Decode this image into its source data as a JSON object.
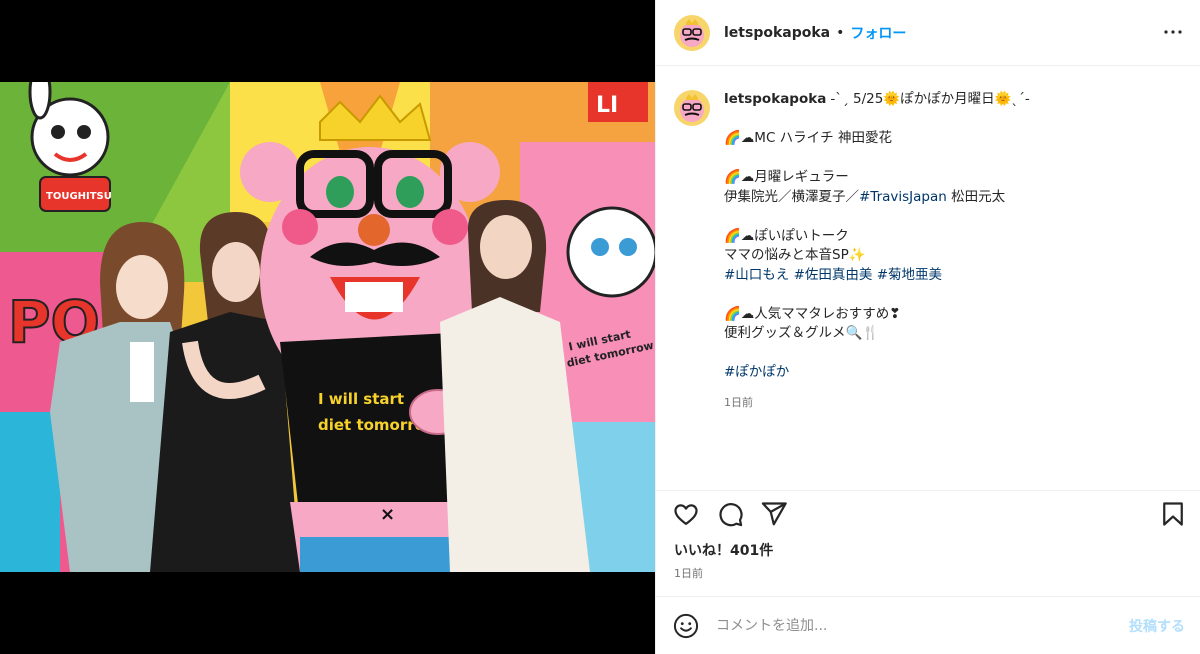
{
  "post": {
    "username": "letspokapoka",
    "follow_label": "フォロー",
    "header_separator": "•",
    "more_icon": "more-horizontal-icon"
  },
  "photo": {
    "shirt_line1": "I will start",
    "shirt_line2": "diet tomorrow",
    "poster_text1": "I will start",
    "poster_text2": "diet tomorrow",
    "sticker_text": "TOUGHITSU",
    "banner_text": "LI",
    "wall_text": "PO"
  },
  "caption": {
    "username": "letspokapoka",
    "lines": [
      "-ˋˏ 5/25🌞ぽかぽか月曜日🌞ˎˊ-",
      "",
      "🌈☁MC ハライチ 神田愛花",
      "",
      "🌈☁月曜レギュラー",
      "伊集院光／横澤夏子／",
      "",
      "🌈☁ぽいぽいトーク",
      "ママの悩みと本音SP✨",
      "",
      "",
      "🌈☁人気ママタレおすすめ❣",
      "便利グッズ＆グルメ🔍🍴",
      ""
    ],
    "line5_tag": "#TravisJapan",
    "line5_rest": " 松田元太",
    "hashtags_line": [
      "#山口もえ",
      "#佐田真由美",
      "#菊地亜美"
    ],
    "final_tag": "#ぽかぽか",
    "time": "1日前"
  },
  "actions": {
    "like_icon": "heart-icon",
    "comment_icon": "comment-icon",
    "share_icon": "send-icon",
    "save_icon": "bookmark-icon",
    "likes_text": "いいね！401件",
    "time": "1日前"
  },
  "comment": {
    "placeholder": "コメントを追加...",
    "post_label": "投稿する",
    "emoji_icon": "smiley-icon"
  },
  "colors": {
    "link": "#00376b",
    "follow": "#0095f6",
    "post_disabled": "#b2dffc",
    "muted": "#737373"
  }
}
